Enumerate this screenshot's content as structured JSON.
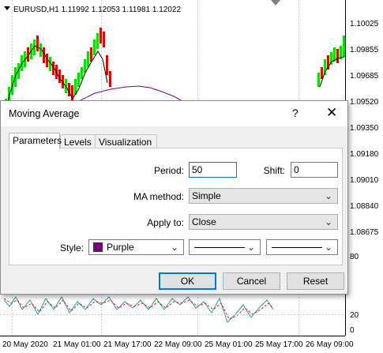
{
  "chart": {
    "header": "EURUSD,H1  1.11992 1.12053 1.11981 1.12022",
    "price_axis": [
      "1.10025",
      "1.09855",
      "1.09685",
      "1.09520",
      "1.09350",
      "1.09180",
      "1.09010",
      "1.08840",
      "1.08675"
    ],
    "indicator_axis": [
      "80",
      "20",
      "0"
    ],
    "time_axis": [
      "20 May 2020",
      "21 May 01:00",
      "21 May 17:00",
      "22 May 09:00",
      "25 May 01:00",
      "25 May 17:00",
      "26 May 09:00"
    ],
    "colors": {
      "bull": "#00e000",
      "bear": "#e00000",
      "ma": "#800080"
    }
  },
  "dialog": {
    "title": "Moving Average",
    "help_glyph": "?",
    "close_glyph": "✕",
    "tabs": [
      "Parameters",
      "Levels",
      "Visualization"
    ],
    "period_label": "Period:",
    "period_value": "50",
    "shift_label": "Shift:",
    "shift_value": "0",
    "method_label": "MA method:",
    "method_value": "Simple",
    "apply_label": "Apply to:",
    "apply_value": "Close",
    "style_label": "Style:",
    "style_color": "Purple",
    "style_color_hex": "#800080",
    "ok": "OK",
    "cancel": "Cancel",
    "reset": "Reset"
  }
}
